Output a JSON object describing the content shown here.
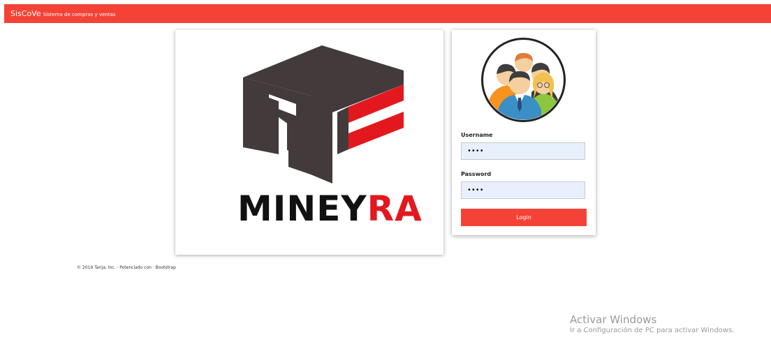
{
  "navbar": {
    "brand": "SisCoVe",
    "subtitle": "Sistema de compras y ventas",
    "color": "#f44336"
  },
  "logo": {
    "word_dark": "MINEY",
    "word_red": "RA",
    "dark_color": "#433a3b",
    "red_color": "#e3181f"
  },
  "login": {
    "avatar_icon": "users-group-icon",
    "username_label": "Username",
    "username_value": "••••",
    "password_label": "Password",
    "password_value": "••••",
    "button_label": "Login"
  },
  "footer": {
    "text": "© 2019 Tarija, Inc. · Potenciado con · Bootstrap"
  },
  "watermark": {
    "title": "Activar Windows",
    "subtitle": "Ir a Configuración de PC para activar Windows."
  }
}
